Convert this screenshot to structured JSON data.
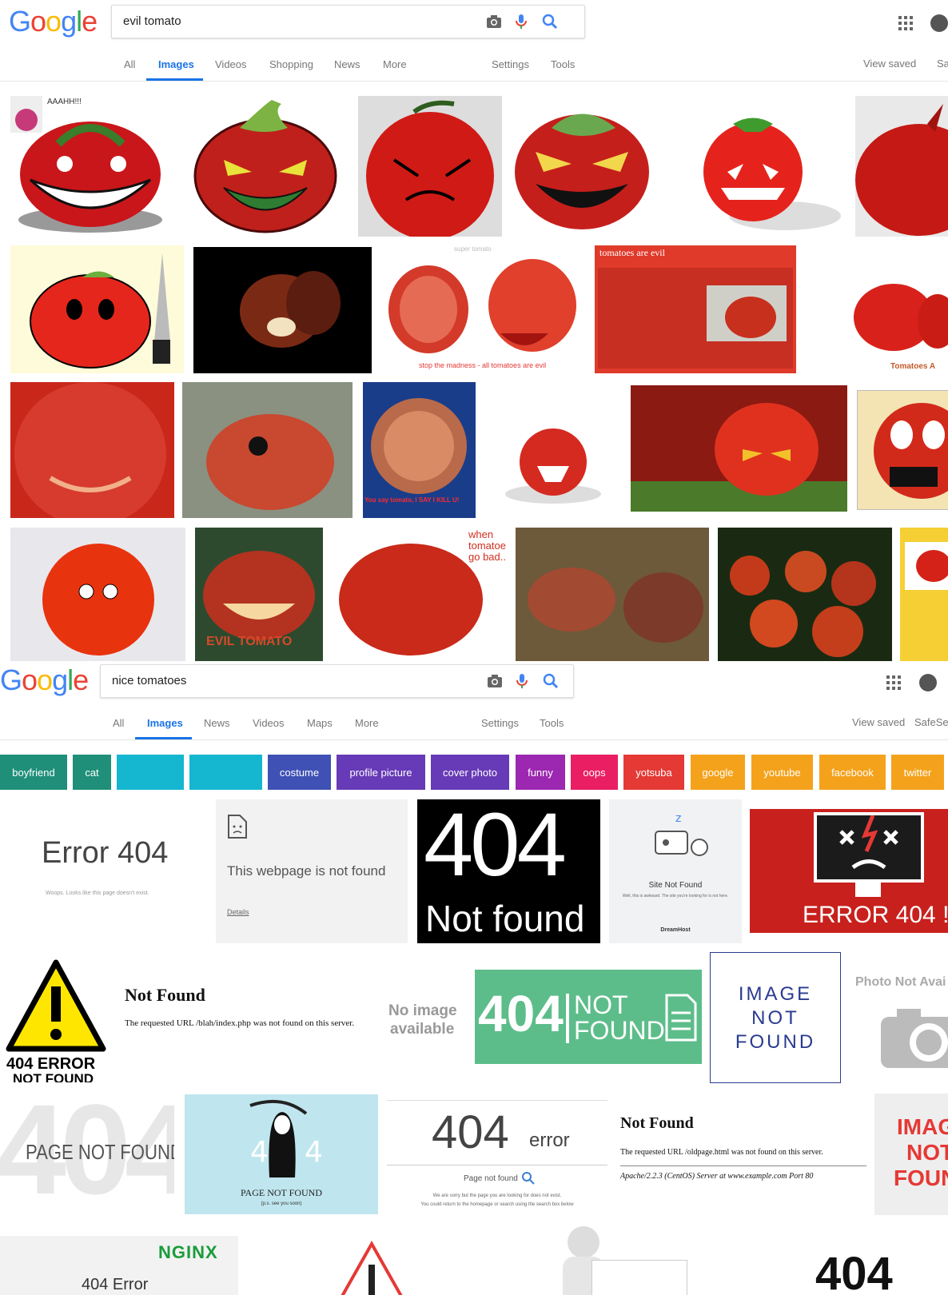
{
  "top": {
    "logo": "Google",
    "query": "evil tomato",
    "tabs": [
      "All",
      "Images",
      "Videos",
      "Shopping",
      "News",
      "More"
    ],
    "tools": [
      "Settings",
      "Tools"
    ],
    "right": [
      "View saved",
      "SafeS"
    ]
  },
  "grid1_labels": {
    "aahh": "AAAHH!!!",
    "super": "super tomato",
    "stop": "stop the madness - all tomatoes are evil",
    "evil_site": "tomatoes are evil",
    "tomatoes_a": "Tomatoes A",
    "you_say": "You say tomato, I SAY I KILL U!",
    "when": "when tomatoe go bad..",
    "evil_tomato": "EVIL TOMATO"
  },
  "bottom": {
    "logo": "Google",
    "query": "nice tomatoes",
    "tabs": [
      "All",
      "Images",
      "News",
      "Videos",
      "Maps",
      "More"
    ],
    "tools": [
      "Settings",
      "Tools"
    ],
    "right": [
      "View saved",
      "SafeSea"
    ]
  },
  "chips": [
    {
      "label": "boyfriend",
      "color": "#1f8f79"
    },
    {
      "label": "cat",
      "color": "#1f8f79"
    },
    {
      "label": "",
      "color": "#14b6d0"
    },
    {
      "label": "",
      "color": "#14b6d0"
    },
    {
      "label": "costume",
      "color": "#3f51b5"
    },
    {
      "label": "profile picture",
      "color": "#673ab7"
    },
    {
      "label": "cover photo",
      "color": "#673ab7"
    },
    {
      "label": "funny",
      "color": "#9c27b0"
    },
    {
      "label": "oops",
      "color": "#e91e63"
    },
    {
      "label": "yotsuba",
      "color": "#e53935"
    },
    {
      "label": "google",
      "color": "#f4a21c"
    },
    {
      "label": "youtube",
      "color": "#f4a21c"
    },
    {
      "label": "facebook",
      "color": "#f4a21c"
    },
    {
      "label": "twitter",
      "color": "#f4a21c"
    }
  ],
  "errors": {
    "e1_title": "Error 404",
    "e1_sub": "Woops. Looks like this page doesn't exist.",
    "e2_title": "This webpage is not found",
    "e2_link": "Details",
    "e3_big": "404",
    "e3_sub": "Not found",
    "e4_title": "Site Not Found",
    "e4_text": "Well, this is awkward. The site you're looking for is not here.",
    "e4_brand": "DreamHost",
    "e5_text": "ERROR 404 !",
    "e6_l1": "404 ERROR",
    "e6_l2": "NOT FOUND",
    "e7_title": "Not Found",
    "e7_text": "The requested URL /blah/index.php was not found on this server.",
    "e8_l1": "No image",
    "e8_l2": "available",
    "e9_big": "404",
    "e9_l1": "NOT",
    "e9_l2": "FOUND",
    "e10_l1": "IMAGE",
    "e10_l2": "NOT",
    "e10_l3": "FOUND",
    "e11_title": "Photo Not Avai",
    "e12_bg": "404",
    "e12_text": "PAGE NOT FOUND",
    "e13_text": "PAGE NOT FOUND",
    "e13_sub": "(p.s. see you soon)",
    "e14_big": "404",
    "e14_err": "error",
    "e14_sub": "Page not found",
    "e14_l1": "We are sorry but the page you are looking for does not exist.",
    "e14_l2": "You could return to the homepage or search using the search box below",
    "e15_title": "Not Found",
    "e15_text": "The requested URL /oldpage.html was not found on this server.",
    "e15_apache": "Apache/2.2.3 (CentOS) Server at www.example.com Port 80",
    "e16_l1": "IMAG",
    "e16_l2": "NOT",
    "e16_l3": "FOUN",
    "e17_brand": "NGINX",
    "e17_title": "404 Error",
    "e18_big": "404"
  }
}
